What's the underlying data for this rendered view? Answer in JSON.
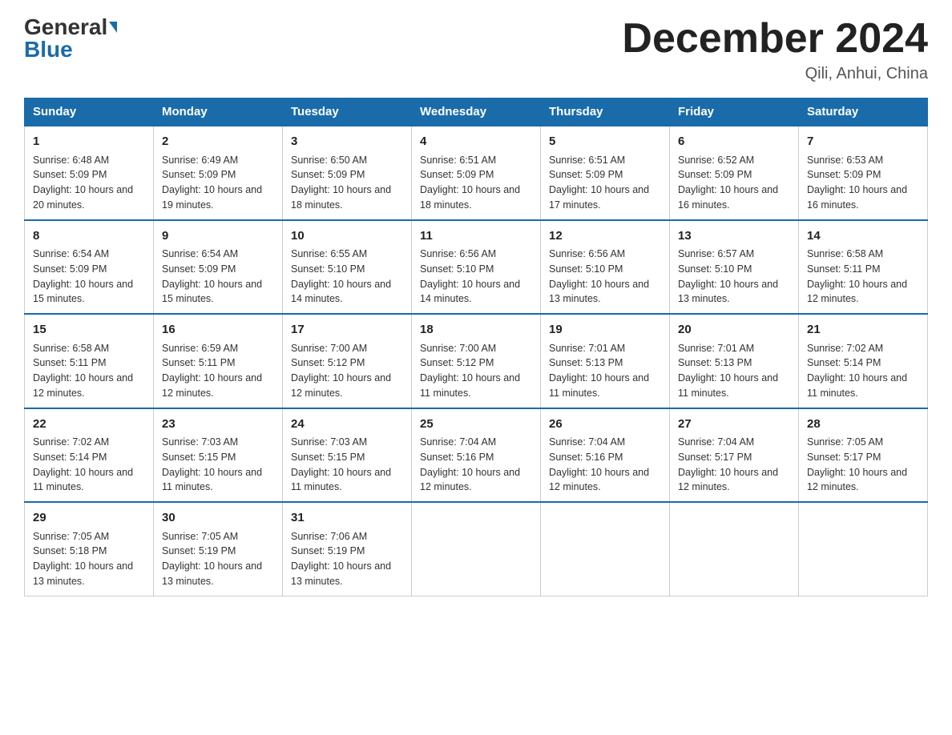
{
  "logo": {
    "general": "General",
    "blue": "Blue"
  },
  "title": {
    "month": "December 2024",
    "location": "Qili, Anhui, China"
  },
  "days_of_week": [
    "Sunday",
    "Monday",
    "Tuesday",
    "Wednesday",
    "Thursday",
    "Friday",
    "Saturday"
  ],
  "weeks": [
    [
      {
        "num": "1",
        "sunrise": "6:48 AM",
        "sunset": "5:09 PM",
        "daylight": "10 hours and 20 minutes."
      },
      {
        "num": "2",
        "sunrise": "6:49 AM",
        "sunset": "5:09 PM",
        "daylight": "10 hours and 19 minutes."
      },
      {
        "num": "3",
        "sunrise": "6:50 AM",
        "sunset": "5:09 PM",
        "daylight": "10 hours and 18 minutes."
      },
      {
        "num": "4",
        "sunrise": "6:51 AM",
        "sunset": "5:09 PM",
        "daylight": "10 hours and 18 minutes."
      },
      {
        "num": "5",
        "sunrise": "6:51 AM",
        "sunset": "5:09 PM",
        "daylight": "10 hours and 17 minutes."
      },
      {
        "num": "6",
        "sunrise": "6:52 AM",
        "sunset": "5:09 PM",
        "daylight": "10 hours and 16 minutes."
      },
      {
        "num": "7",
        "sunrise": "6:53 AM",
        "sunset": "5:09 PM",
        "daylight": "10 hours and 16 minutes."
      }
    ],
    [
      {
        "num": "8",
        "sunrise": "6:54 AM",
        "sunset": "5:09 PM",
        "daylight": "10 hours and 15 minutes."
      },
      {
        "num": "9",
        "sunrise": "6:54 AM",
        "sunset": "5:09 PM",
        "daylight": "10 hours and 15 minutes."
      },
      {
        "num": "10",
        "sunrise": "6:55 AM",
        "sunset": "5:10 PM",
        "daylight": "10 hours and 14 minutes."
      },
      {
        "num": "11",
        "sunrise": "6:56 AM",
        "sunset": "5:10 PM",
        "daylight": "10 hours and 14 minutes."
      },
      {
        "num": "12",
        "sunrise": "6:56 AM",
        "sunset": "5:10 PM",
        "daylight": "10 hours and 13 minutes."
      },
      {
        "num": "13",
        "sunrise": "6:57 AM",
        "sunset": "5:10 PM",
        "daylight": "10 hours and 13 minutes."
      },
      {
        "num": "14",
        "sunrise": "6:58 AM",
        "sunset": "5:11 PM",
        "daylight": "10 hours and 12 minutes."
      }
    ],
    [
      {
        "num": "15",
        "sunrise": "6:58 AM",
        "sunset": "5:11 PM",
        "daylight": "10 hours and 12 minutes."
      },
      {
        "num": "16",
        "sunrise": "6:59 AM",
        "sunset": "5:11 PM",
        "daylight": "10 hours and 12 minutes."
      },
      {
        "num": "17",
        "sunrise": "7:00 AM",
        "sunset": "5:12 PM",
        "daylight": "10 hours and 12 minutes."
      },
      {
        "num": "18",
        "sunrise": "7:00 AM",
        "sunset": "5:12 PM",
        "daylight": "10 hours and 11 minutes."
      },
      {
        "num": "19",
        "sunrise": "7:01 AM",
        "sunset": "5:13 PM",
        "daylight": "10 hours and 11 minutes."
      },
      {
        "num": "20",
        "sunrise": "7:01 AM",
        "sunset": "5:13 PM",
        "daylight": "10 hours and 11 minutes."
      },
      {
        "num": "21",
        "sunrise": "7:02 AM",
        "sunset": "5:14 PM",
        "daylight": "10 hours and 11 minutes."
      }
    ],
    [
      {
        "num": "22",
        "sunrise": "7:02 AM",
        "sunset": "5:14 PM",
        "daylight": "10 hours and 11 minutes."
      },
      {
        "num": "23",
        "sunrise": "7:03 AM",
        "sunset": "5:15 PM",
        "daylight": "10 hours and 11 minutes."
      },
      {
        "num": "24",
        "sunrise": "7:03 AM",
        "sunset": "5:15 PM",
        "daylight": "10 hours and 11 minutes."
      },
      {
        "num": "25",
        "sunrise": "7:04 AM",
        "sunset": "5:16 PM",
        "daylight": "10 hours and 12 minutes."
      },
      {
        "num": "26",
        "sunrise": "7:04 AM",
        "sunset": "5:16 PM",
        "daylight": "10 hours and 12 minutes."
      },
      {
        "num": "27",
        "sunrise": "7:04 AM",
        "sunset": "5:17 PM",
        "daylight": "10 hours and 12 minutes."
      },
      {
        "num": "28",
        "sunrise": "7:05 AM",
        "sunset": "5:17 PM",
        "daylight": "10 hours and 12 minutes."
      }
    ],
    [
      {
        "num": "29",
        "sunrise": "7:05 AM",
        "sunset": "5:18 PM",
        "daylight": "10 hours and 13 minutes."
      },
      {
        "num": "30",
        "sunrise": "7:05 AM",
        "sunset": "5:19 PM",
        "daylight": "10 hours and 13 minutes."
      },
      {
        "num": "31",
        "sunrise": "7:06 AM",
        "sunset": "5:19 PM",
        "daylight": "10 hours and 13 minutes."
      },
      null,
      null,
      null,
      null
    ]
  ],
  "labels": {
    "sunrise": "Sunrise:",
    "sunset": "Sunset:",
    "daylight": "Daylight:"
  }
}
